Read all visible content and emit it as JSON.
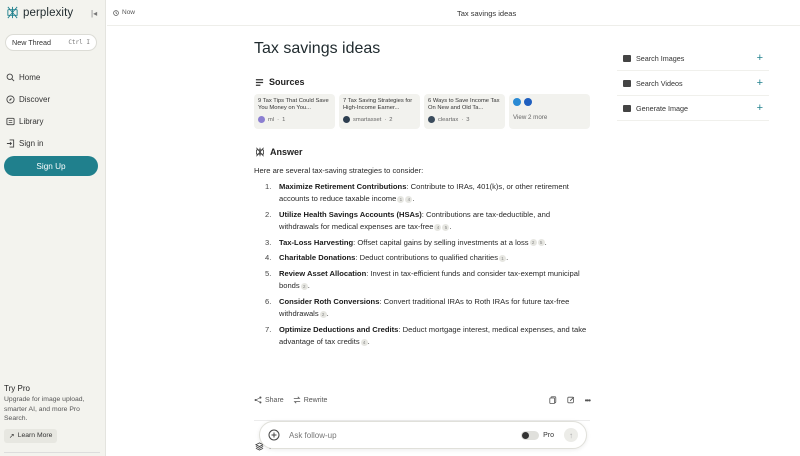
{
  "brand": {
    "name": "perplexity"
  },
  "sidebar": {
    "new_thread": "New Thread",
    "shortcut": "Ctrl I",
    "nav": [
      {
        "label": "Home",
        "icon": "search-icon"
      },
      {
        "label": "Discover",
        "icon": "compass-icon"
      },
      {
        "label": "Library",
        "icon": "library-icon"
      },
      {
        "label": "Sign in",
        "icon": "signin-icon"
      }
    ],
    "signup": "Sign Up",
    "pro": {
      "title": "Try Pro",
      "desc": "Upgrade for image upload, smarter AI, and more Pro Search.",
      "learn_more": "Learn More"
    }
  },
  "topbar": {
    "time": "Now",
    "title": "Tax savings ideas"
  },
  "main": {
    "title": "Tax savings ideas",
    "sources_label": "Sources",
    "sources": [
      {
        "title": "9 Tax Tips That Could Save You Money on You...",
        "site": "ml",
        "index": "1",
        "favicon_color": "#8b7fd1"
      },
      {
        "title": "7 Tax Saving Strategies for High-Income Earner...",
        "site": "smartasset",
        "index": "2",
        "favicon_color": "#2d3e50"
      },
      {
        "title": "6 Ways to Save Income Tax On New and Old Ta...",
        "site": "cleartax",
        "index": "3",
        "favicon_color": "#3a4b5c"
      }
    ],
    "view_more": "View 2 more",
    "answer_label": "Answer",
    "intro": "Here are several tax-saving strategies to consider:",
    "items": [
      {
        "num": "1.",
        "term": "Maximize Retirement Contributions",
        "text": ": Contribute to IRAs, 401(k)s, or other retirement accounts to reduce taxable income",
        "cites": [
          "1",
          "4"
        ],
        "end": "."
      },
      {
        "num": "2.",
        "term": "Utilize Health Savings Accounts (HSAs)",
        "text": ": Contributions are tax-deductible, and withdrawals for medical expenses are tax-free",
        "cites": [
          "4",
          "5"
        ],
        "end": "."
      },
      {
        "num": "3.",
        "term": "Tax-Loss Harvesting",
        "text": ": Offset capital gains by selling investments at a loss",
        "cites": [
          "2",
          "5"
        ],
        "end": "."
      },
      {
        "num": "4.",
        "term": "Charitable Donations",
        "text": ": Deduct contributions to qualified charities",
        "cites": [
          "1"
        ],
        "end": "."
      },
      {
        "num": "5.",
        "term": "Review Asset Allocation",
        "text": ": Invest in tax-efficient funds and consider tax-exempt municipal bonds",
        "cites": [
          "2"
        ],
        "end": "."
      },
      {
        "num": "6.",
        "term": "Consider Roth Conversions",
        "text": ": Convert traditional IRAs to Roth IRAs for future tax-free withdrawals",
        "cites": [
          "2"
        ],
        "end": "."
      },
      {
        "num": "7.",
        "term": "Optimize Deductions and Credits",
        "text": ": Deduct mortgage interest, medical expenses, and take advantage of tax credits",
        "cites": [
          "4"
        ],
        "end": "."
      }
    ],
    "share": "Share",
    "rewrite": "Rewrite",
    "related_label": "Related"
  },
  "followup": {
    "placeholder": "Ask follow-up",
    "pro_label": "Pro"
  },
  "right_panel": [
    {
      "label": "Search Images",
      "icon": "image-icon"
    },
    {
      "label": "Search Videos",
      "icon": "video-icon"
    },
    {
      "label": "Generate Image",
      "icon": "generate-image-icon"
    }
  ],
  "colors": {
    "accent": "#20808d",
    "sidebar_bg": "#f3f3ee"
  }
}
